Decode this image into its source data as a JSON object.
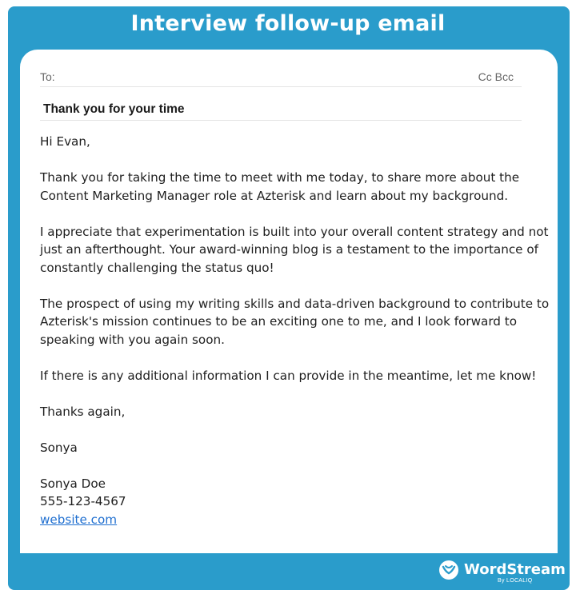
{
  "header": {
    "title": "Interview follow-up email"
  },
  "email": {
    "to_label": "To:",
    "cc_bcc_label": "Cc Bcc",
    "subject": "Thank you for your time",
    "greeting": "Hi Evan,",
    "paragraph_1": "Thank you for taking the time to meet with me today, to share more about the Content Marketing Manager role at Azterisk and learn about my background.",
    "paragraph_2": "I appreciate that experimentation is built into your overall content strategy and not just an afterthought. Your award-winning blog is a testament to the importance of constantly challenging the status quo!",
    "paragraph_3": "The prospect of using my writing skills and data-driven background to contribute to Azterisk's mission continues to be an exciting one to me, and I look forward to speaking with you again soon.",
    "paragraph_4": "If there is any additional information I can provide in the meantime, let me know!",
    "closing": "Thanks again,",
    "first_name": "Sonya",
    "signature": {
      "full_name": "Sonya Doe",
      "phone": "555-123-4567",
      "website": "website.com"
    }
  },
  "footer": {
    "logo_icon": "wordstream-logo-icon",
    "brand": "WordStream",
    "byline": "By LOCALIQ"
  },
  "colors": {
    "frame": "#2a9ccb",
    "link": "#1f6fd0"
  }
}
